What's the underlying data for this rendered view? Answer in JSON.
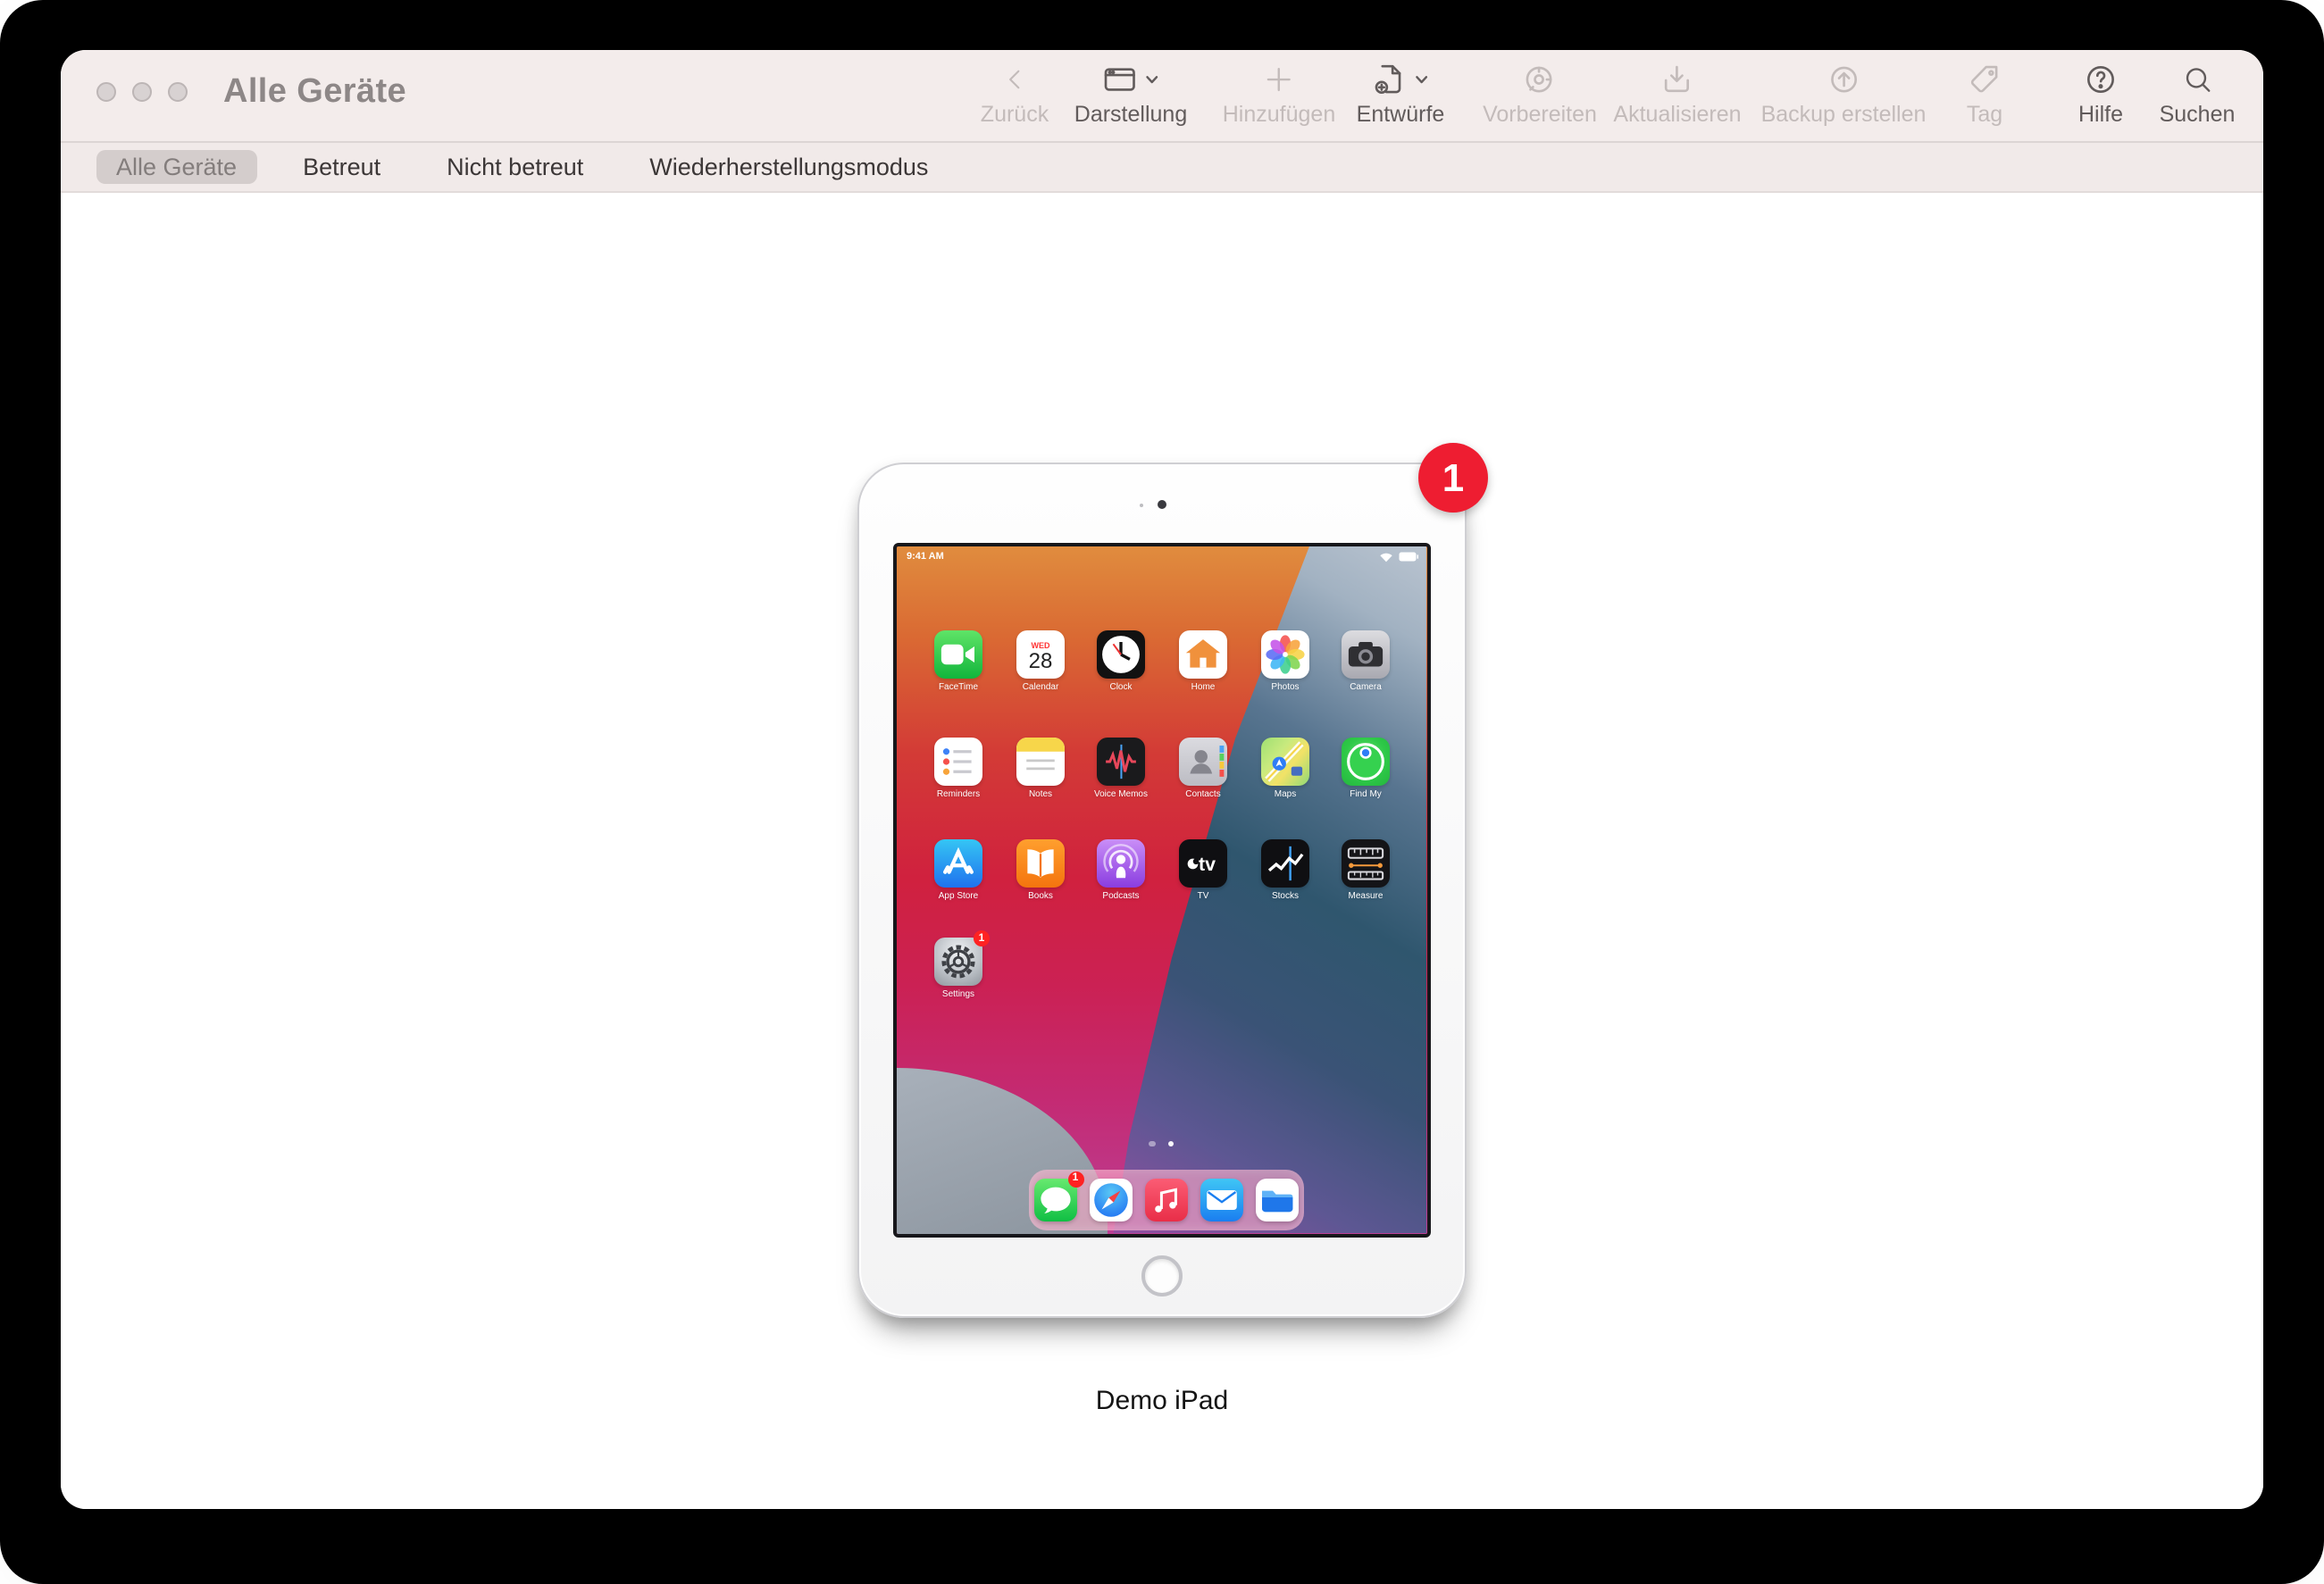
{
  "window": {
    "title": "Alle Geräte"
  },
  "toolbar": {
    "items": [
      {
        "id": "back",
        "label": "Zurück",
        "icon": "chevron-left-icon",
        "enabled": false,
        "chevron": false
      },
      {
        "id": "view",
        "label": "Darstellung",
        "icon": "window-icon",
        "enabled": true,
        "chevron": true
      },
      {
        "id": "add",
        "label": "Hinzufügen",
        "icon": "plus-icon",
        "enabled": false,
        "chevron": false
      },
      {
        "id": "blueprints",
        "label": "Entwürfe",
        "icon": "document-plus-icon",
        "enabled": true,
        "chevron": true
      },
      {
        "id": "prepare",
        "label": "Vorbereiten",
        "icon": "dial-icon",
        "enabled": false,
        "chevron": false
      },
      {
        "id": "update",
        "label": "Aktualisieren",
        "icon": "arrow-down-tray-icon",
        "enabled": false,
        "chevron": false
      },
      {
        "id": "backup",
        "label": "Backup erstellen",
        "icon": "arrow-up-circle-icon",
        "enabled": false,
        "chevron": false
      },
      {
        "id": "tag",
        "label": "Tag",
        "icon": "tag-icon",
        "enabled": false,
        "chevron": false
      },
      {
        "id": "help",
        "label": "Hilfe",
        "icon": "question-circle-icon",
        "enabled": true,
        "chevron": false
      },
      {
        "id": "search",
        "label": "Suchen",
        "icon": "magnifier-icon",
        "enabled": true,
        "chevron": false
      }
    ]
  },
  "tabs": {
    "items": [
      {
        "label": "Alle Geräte",
        "selected": true
      },
      {
        "label": "Betreut",
        "selected": false
      },
      {
        "label": "Nicht betreut",
        "selected": false
      },
      {
        "label": "Wiederherstellungsmodus",
        "selected": false
      }
    ]
  },
  "device": {
    "name": "Demo iPad",
    "notification_badge": "1",
    "status_bar": {
      "time": "9:41 AM",
      "icons": [
        "wifi-icon",
        "battery-icon"
      ]
    },
    "calendar": {
      "weekday": "WED",
      "day": "28"
    },
    "home_rows": [
      [
        {
          "id": "facetime",
          "label": "FaceTime"
        },
        {
          "id": "calendar",
          "label": "Calendar"
        },
        {
          "id": "clock",
          "label": "Clock"
        },
        {
          "id": "home",
          "label": "Home"
        },
        {
          "id": "photos",
          "label": "Photos"
        },
        {
          "id": "camera",
          "label": "Camera"
        }
      ],
      [
        {
          "id": "reminders",
          "label": "Reminders"
        },
        {
          "id": "notes",
          "label": "Notes"
        },
        {
          "id": "voicememos",
          "label": "Voice Memos"
        },
        {
          "id": "contacts",
          "label": "Contacts"
        },
        {
          "id": "maps",
          "label": "Maps"
        },
        {
          "id": "findmy",
          "label": "Find My"
        }
      ],
      [
        {
          "id": "appstore",
          "label": "App Store"
        },
        {
          "id": "books",
          "label": "Books"
        },
        {
          "id": "podcasts",
          "label": "Podcasts"
        },
        {
          "id": "tv",
          "label": "TV"
        },
        {
          "id": "stocks",
          "label": "Stocks"
        },
        {
          "id": "measure",
          "label": "Measure"
        }
      ],
      [
        {
          "id": "settings",
          "label": "Settings",
          "badge": "1"
        }
      ]
    ],
    "dock": [
      {
        "id": "messages",
        "badge": "1"
      },
      {
        "id": "safari"
      },
      {
        "id": "music"
      },
      {
        "id": "mail"
      },
      {
        "id": "files"
      }
    ],
    "page_dots": {
      "count": 2,
      "active_index": 1
    }
  },
  "colors": {
    "badge_red": "#ee1d31",
    "chrome_bg": "#f3eceb",
    "selected_tab_bg": "#d4cdcc",
    "toolbar_enabled_text": "#615b5b",
    "toolbar_disabled_text": "#c3bbba"
  }
}
